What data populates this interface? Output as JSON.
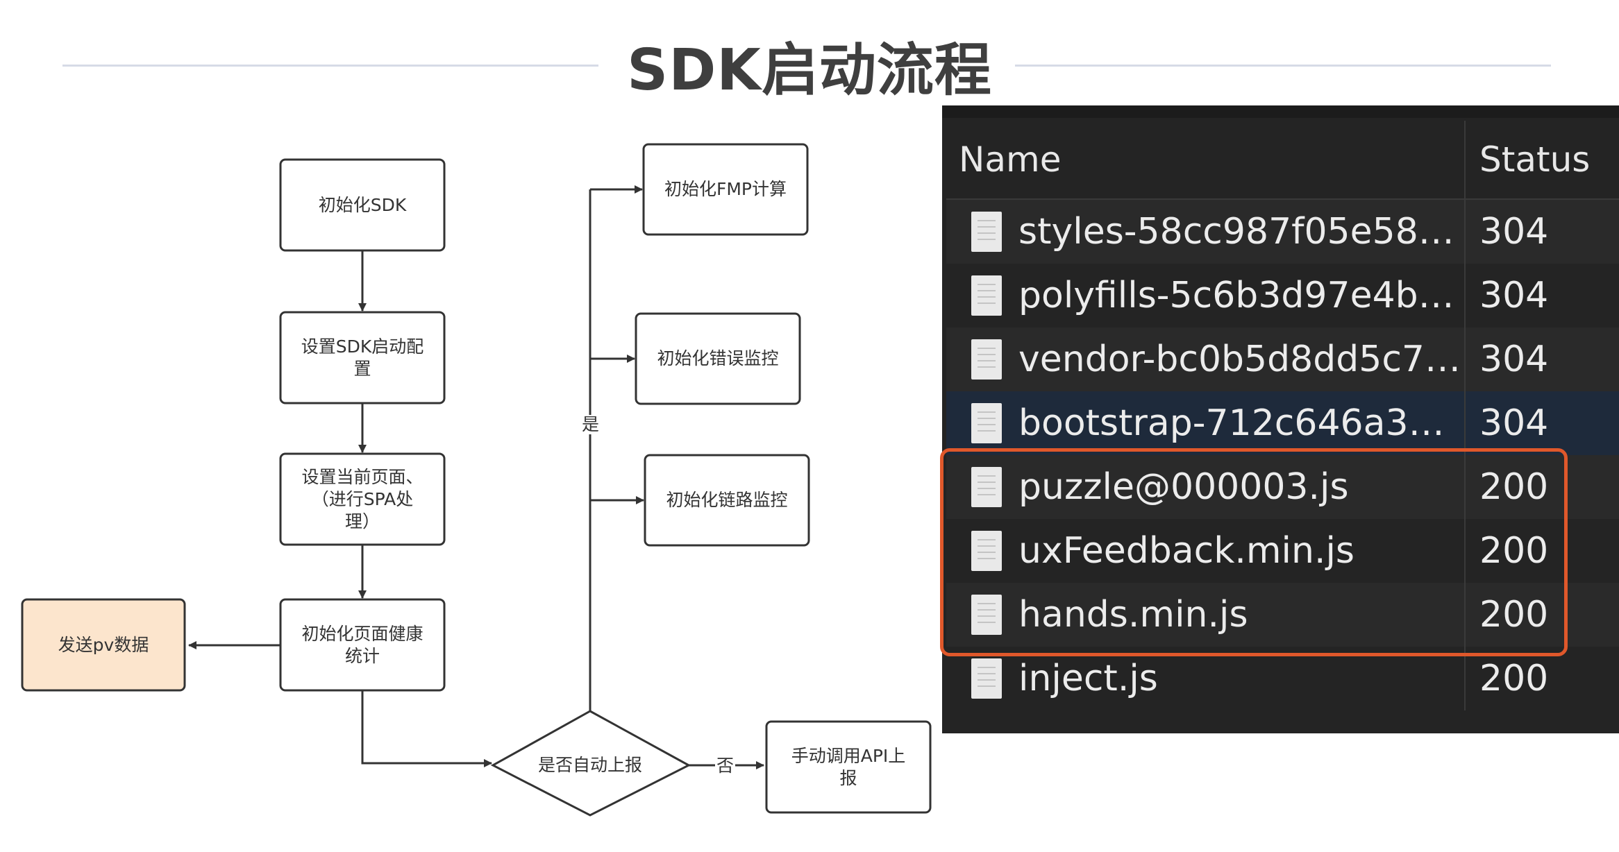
{
  "page": {
    "title": "SDK启动流程"
  },
  "flowchart": {
    "nodes": {
      "init_sdk": "初始化SDK",
      "set_config": "设置SDK启动配\n置",
      "set_page": "设置当前页面、\n（进行SPA处\n理）",
      "init_health": "初始化页面健康\n统计",
      "send_pv": "发送pv数据",
      "auto_report": "是否自动上报",
      "manual_api": "手动调用API上\n报",
      "init_fmp": "初始化FMP计算",
      "init_error": "初始化错误监控",
      "init_trace": "初始化链路监控"
    },
    "edge_labels": {
      "yes": "是",
      "no": "否"
    },
    "colors": {
      "node_border": "#333333",
      "highlight_node_fill": "#fce5cd"
    }
  },
  "network_panel": {
    "columns": {
      "name": "Name",
      "status": "Status"
    },
    "rows": [
      {
        "name": "styles-58cc987f05e582a…",
        "status": "304",
        "selected": false
      },
      {
        "name": "polyfills-5c6b3d97e4b0…",
        "status": "304",
        "selected": false
      },
      {
        "name": "vendor-bc0b5d8dd5c7f…",
        "status": "304",
        "selected": false
      },
      {
        "name": "bootstrap-712c646a389…",
        "status": "304",
        "selected": true
      },
      {
        "name": "puzzle@000003.js",
        "status": "200",
        "selected": false
      },
      {
        "name": "uxFeedback.min.js",
        "status": "200",
        "selected": false
      },
      {
        "name": "hands.min.js",
        "status": "200",
        "selected": false
      },
      {
        "name": "inject.js",
        "status": "200",
        "selected": false
      }
    ],
    "row_colors": [
      "#2a2a2a",
      "#242424",
      "#2a2a2a",
      "#1e2a3b",
      "#2a2a2a",
      "#242424",
      "#2a2a2a",
      "#242424"
    ],
    "highlight_color": "#e0582b",
    "icon": "file-document-icon"
  }
}
